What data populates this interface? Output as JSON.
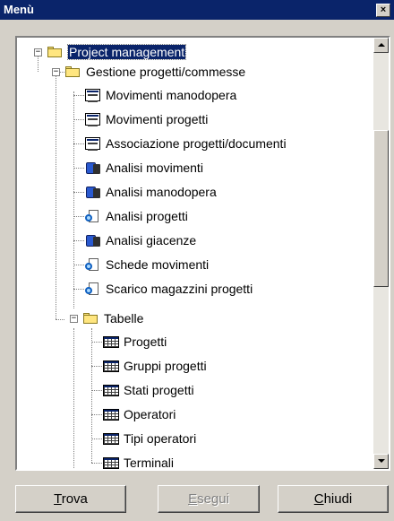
{
  "window": {
    "title": "Menù"
  },
  "tree": {
    "root": {
      "label": "Project management",
      "icon": "folder-open-icon",
      "selected": true
    },
    "group1": {
      "label": "Gestione progetti/commesse",
      "icon": "folder-open-icon",
      "items": [
        {
          "label": "Movimenti manodopera",
          "icon": "form-icon"
        },
        {
          "label": "Movimenti progetti",
          "icon": "form-icon"
        },
        {
          "label": "Associazione progetti/documenti",
          "icon": "form-icon"
        },
        {
          "label": "Analisi movimenti",
          "icon": "report-icon"
        },
        {
          "label": "Analisi manodopera",
          "icon": "report-icon"
        },
        {
          "label": "Analisi progetti",
          "icon": "search-icon"
        },
        {
          "label": "Analisi giacenze",
          "icon": "report-icon"
        },
        {
          "label": "Schede movimenti",
          "icon": "search-icon"
        },
        {
          "label": "Scarico magazzini progetti",
          "icon": "search-icon"
        }
      ]
    },
    "group2": {
      "label": "Tabelle",
      "icon": "folder-open-icon",
      "items": [
        {
          "label": "Progetti",
          "icon": "table-icon"
        },
        {
          "label": "Gruppi progetti",
          "icon": "table-icon"
        },
        {
          "label": "Stati progetti",
          "icon": "table-icon"
        },
        {
          "label": "Operatori",
          "icon": "table-icon"
        },
        {
          "label": "Tipi operatori",
          "icon": "table-icon"
        },
        {
          "label": "Terminali",
          "icon": "table-icon"
        }
      ]
    }
  },
  "buttons": {
    "trova": {
      "label": "Trova",
      "accel": "T",
      "rest": "rova",
      "enabled": true
    },
    "esegui": {
      "label": "Esegui",
      "accel": "E",
      "rest": "segui",
      "enabled": false
    },
    "chiudi": {
      "label": "Chiudi",
      "accel": "C",
      "rest": "hiudi",
      "enabled": true
    }
  },
  "colors": {
    "titlebar": "#0a246a",
    "face": "#d4d0c8",
    "selection": "#0a246a"
  }
}
